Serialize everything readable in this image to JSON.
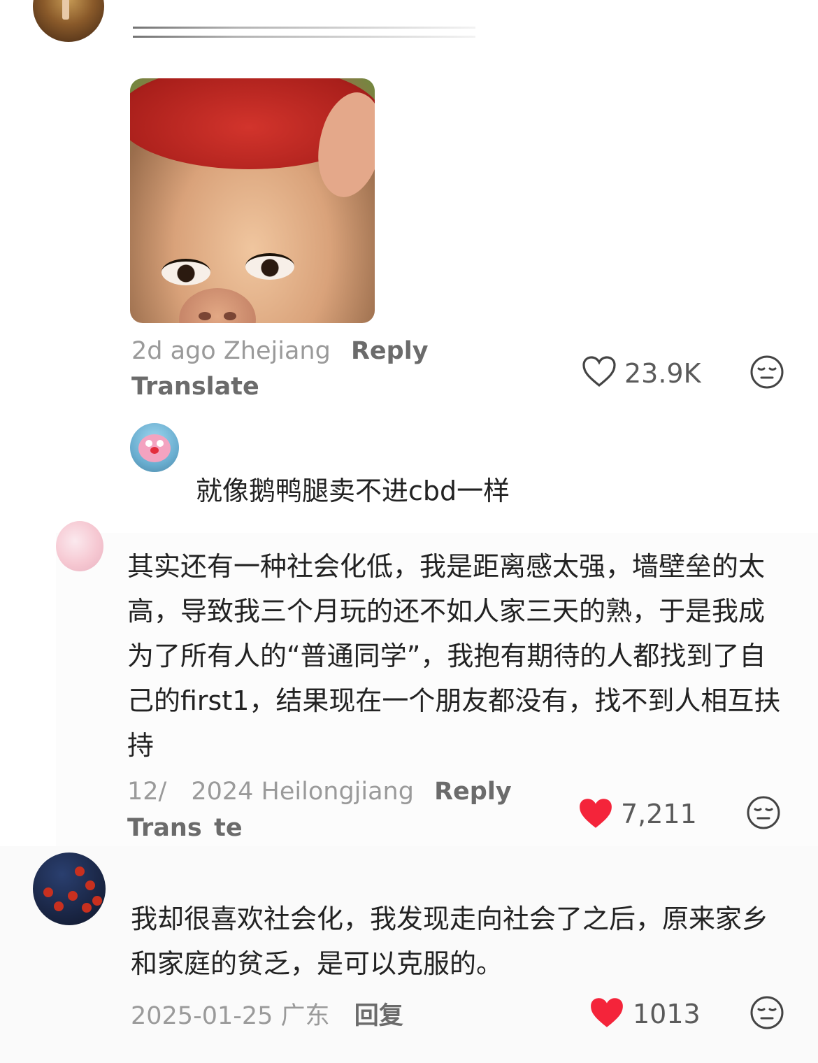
{
  "comments": [
    {
      "time": "2d ago",
      "location": "Zhejiang",
      "reply_label": "Reply",
      "translate_label": "Translate",
      "likes": "23.9K",
      "liked": false
    },
    {
      "text": "就像鹅鸭腿卖不进cbd一样"
    },
    {
      "text": "其实还有一种社会化低，我是距离感太强，墙壁垒的太高，导致我三个月玩的还不如人家三天的熟，于是我成为了所有人的“普通同学”，我抱有期待的人都找到了自己的first1，结果现在一个朋友都没有，找不到人相互扶持",
      "date": "12/  2024",
      "location": "Heilongjiang",
      "reply_label": "Reply",
      "translate_label": "Trans te",
      "likes": "7,211",
      "liked": true
    },
    {
      "text": "我却很喜欢社会化，我发现走向社会了之后，原来家乡和家庭的贫乏，是可以克服的。",
      "date": "2025-01-25",
      "location": "广东",
      "reply_label": "回复",
      "likes": "1013",
      "liked": true
    }
  ],
  "colors": {
    "heart": "#f4243a",
    "meta": "#9a9a9a",
    "text": "#222222"
  }
}
